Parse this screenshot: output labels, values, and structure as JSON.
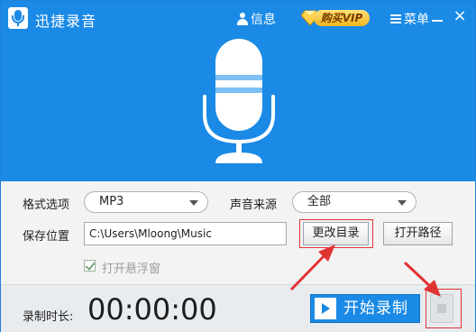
{
  "window": {
    "title": "迅捷录音",
    "info_label": "信息",
    "vip_label": "购买VIP",
    "menu_label": "菜单",
    "close_glyph": "×"
  },
  "settings": {
    "format_label": "格式选项",
    "format_value": "MP3",
    "source_label": "声音来源",
    "source_value": "全部",
    "save_label": "保存位置",
    "save_path": "C:\\Users\\Mloong\\Music",
    "change_dir_label": "更改目录",
    "open_path_label": "打开路径",
    "float_window_label": "打开悬浮窗"
  },
  "recorder": {
    "duration_label": "录制时长:",
    "duration_value": "00:00:00",
    "start_label": "开始录制"
  },
  "colors": {
    "brand_blue": "#1a8ae6",
    "highlight_red": "#e23333"
  },
  "icons": [
    "microphone-icon",
    "user-icon",
    "vip-diamond-icon",
    "menu-icon",
    "minimize-icon",
    "close-icon",
    "play-icon",
    "stop-icon",
    "checkmark-icon",
    "dropdown-arrow-icon"
  ]
}
